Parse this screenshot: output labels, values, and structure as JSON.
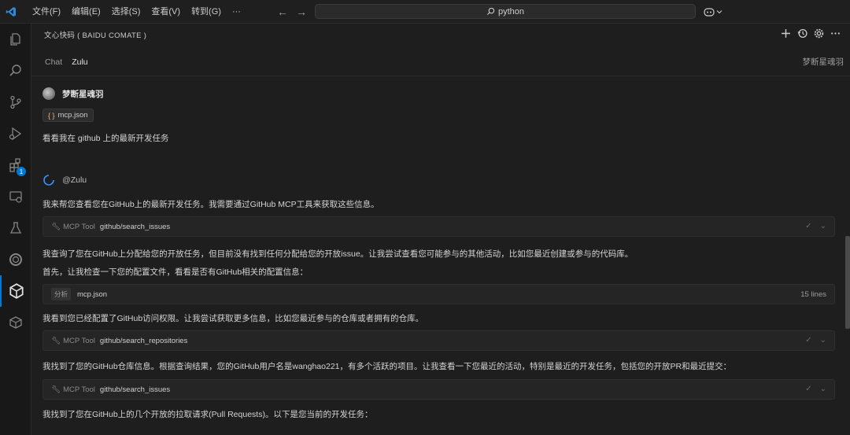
{
  "titlebar": {
    "menu": [
      "文件(F)",
      "编辑(E)",
      "选择(S)",
      "查看(V)",
      "转到(G)",
      "···"
    ],
    "search_text": "python"
  },
  "activity": {
    "extensions_badge": "1"
  },
  "panel": {
    "title": "文心快码 ( BAIDU COMATE )",
    "tabs": [
      "Chat",
      "Zulu"
    ],
    "user_display": "梦断星魂羽"
  },
  "chat": {
    "user_name": "梦断星魂羽",
    "attached_file": "mcp.json",
    "user_message": "看看我在 github 上的最新开发任务",
    "bot_name": "@Zulu",
    "msg1": "我来帮您查看您在GitHub上的最新开发任务。我需要通过GitHub MCP工具来获取这些信息。",
    "tool1_label": "MCP Tool",
    "tool1_name": "github/search_issues",
    "msg2": "我查询了您在GitHub上分配给您的开放任务，但目前没有找到任何分配给您的开放issue。让我尝试查看您可能参与的其他活动，比如您最近创建或参与的代码库。",
    "msg3": "首先，让我检查一下您的配置文件，看看是否有GitHub相关的配置信息：",
    "file_tag": "分析",
    "file_name": "mcp.json",
    "file_lines": "15 lines",
    "msg4": "我看到您已经配置了GitHub访问权限。让我尝试获取更多信息，比如您最近参与的仓库或者拥有的仓库。",
    "tool2_label": "MCP Tool",
    "tool2_name": "github/search_repositories",
    "msg5": "我找到了您的GitHub仓库信息。根据查询结果，您的GitHub用户名是wanghao221，有多个活跃的项目。让我查看一下您最近的活动，特别是最近的开发任务，包括您的开放PR和最近提交：",
    "tool3_label": "MCP Tool",
    "tool3_name": "github/search_issues",
    "msg6": "我找到了您在GitHub上的几个开放的拉取请求(Pull Requests)。以下是您当前的开发任务："
  }
}
